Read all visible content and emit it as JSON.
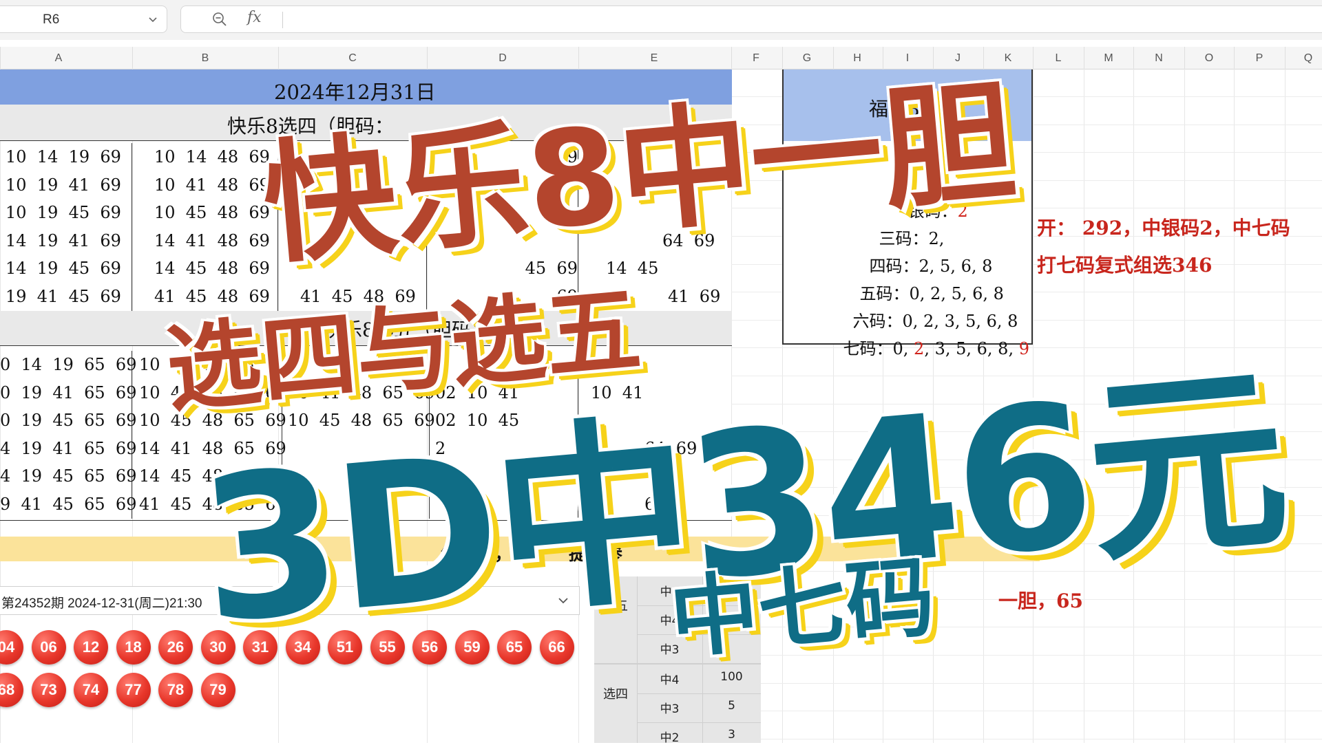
{
  "formula_bar": {
    "cell_ref": "R6",
    "fx_label": "fx"
  },
  "columns": [
    "A",
    "B",
    "C",
    "D",
    "E",
    "F",
    "G",
    "H",
    "I",
    "J",
    "K",
    "L",
    "M",
    "N",
    "O",
    "P",
    "Q"
  ],
  "sheet": {
    "date_title": "2024年12月31日",
    "section_top_label": "快乐8选四（胆码：",
    "section_mid_label": "快乐8选五（胆码：",
    "block_a": [
      "10  14  19  69",
      "10  19  41  69",
      "10  19  45  69",
      "14  19  41  69",
      "14  19  45  69",
      "19  41  45  69"
    ],
    "block_b": [
      "10  14  48  69",
      "10  41  48  69",
      "10  45  48  69",
      "14  41  48  69",
      "14  45  48  69",
      "41  45  48  69"
    ],
    "block_c_tail": "41  45  48  69",
    "block_d": [
      "4  69",
      "",
      "",
      "",
      "45  69",
      "69"
    ],
    "block_e": [
      "",
      "",
      "",
      "64  69",
      "14  45",
      "41  69"
    ],
    "block_5a": [
      "0  14  19  65  69",
      "0  19  41  65  69",
      "0  19  45  65  69",
      "4  19  41  65  69",
      "4  19  45  65  69",
      "9  41  45  65  69"
    ],
    "block_5b": [
      "10  14  48  65  69",
      "10  41  48  65  69",
      "10  45  48  65  69",
      "14  41  48  65  69",
      "14  45  48  65  69",
      "41  45  48  65  69"
    ],
    "block_5c": [
      "",
      "10  41  48  65  69",
      "10  45  48  65  69",
      "",
      "",
      "65"
    ],
    "block_5d": [
      "",
      "02  10  41",
      "02  10  45",
      "2",
      "",
      ""
    ],
    "block_5e": [
      "",
      "10  41",
      "",
      "64  69",
      "",
      "64"
    ],
    "yellow_text_a": "组合号，",
    "yellow_text_b": "提供参"
  },
  "draw": {
    "period_label": "第24352期 2024-12-31(周二)21:30",
    "balls_row1": [
      "04",
      "06",
      "12",
      "18",
      "26",
      "30",
      "31",
      "34",
      "51",
      "55",
      "56",
      "59",
      "65",
      "66"
    ],
    "balls_row2": [
      "68",
      "73",
      "74",
      "77",
      "78",
      "79"
    ]
  },
  "prize_table": {
    "group_five": "选五",
    "group_four": "选四",
    "rows": [
      {
        "level": "中5",
        "amount": ""
      },
      {
        "level": "中4",
        "amount": ""
      },
      {
        "level": "中3",
        "amount": ""
      },
      {
        "level": "中4",
        "amount": "100"
      },
      {
        "level": "中3",
        "amount": "5"
      },
      {
        "level": "中2",
        "amount": "3"
      }
    ]
  },
  "fucai3d": {
    "title": "福彩3D",
    "lines": [
      {
        "label": "银码：",
        "values": "2"
      },
      {
        "label": "三码：",
        "values": "2,"
      },
      {
        "label": "四码：",
        "values": "2, 5, 6, 8"
      },
      {
        "label": "五码：",
        "values": "0, 2, 5, 6, 8"
      },
      {
        "label": "六码：",
        "values": "0, 2, 3, 5, 6, 8"
      },
      {
        "label": "七码：",
        "values_a": "0, ",
        "values_red": "2",
        "values_b": ", 3, 5, 6, 8, ",
        "values_red2": "9"
      }
    ],
    "note_line1": "开： 292，中银码2，中七码",
    "note_line2": "打七码复式组选346",
    "note_line3": "一胆，65"
  },
  "overlay": {
    "line1": "快乐8中一胆",
    "line2": "选四与选五",
    "line3": "3D中346元",
    "line4": "中七码"
  },
  "colors": {
    "title_red": "#b4452d",
    "title_teal": "#0f6d86",
    "title_shadow_yellow": "#f6d21a",
    "date_band_blue": "#7fa0e0",
    "ball_red": "#e8372b",
    "note_red": "#c8261d"
  }
}
